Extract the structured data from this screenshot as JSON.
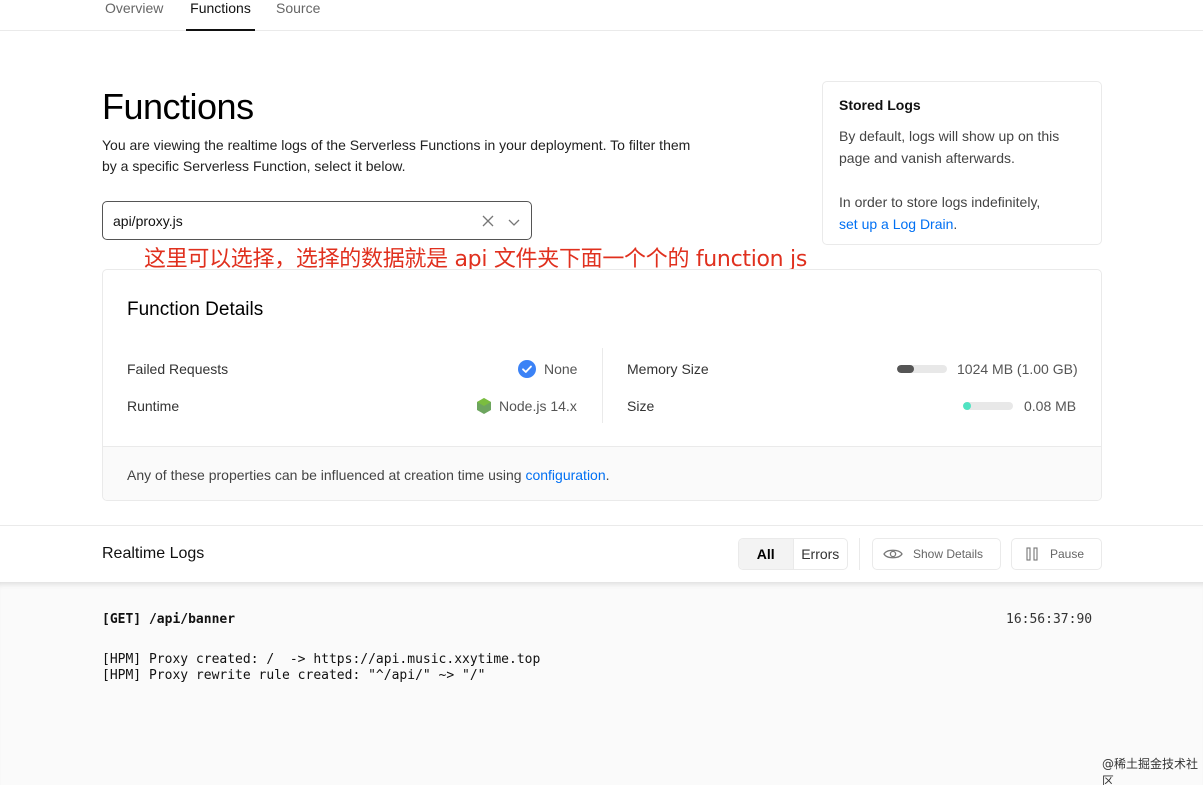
{
  "tabs": [
    {
      "label": "Overview",
      "active": false
    },
    {
      "label": "Functions",
      "active": true
    },
    {
      "label": "Source",
      "active": false
    }
  ],
  "page": {
    "title": "Functions",
    "description": "You are viewing the realtime logs of the Serverless Functions in your deployment. To filter them by a specific Serverless Function, select it below."
  },
  "function_select": {
    "value": "api/proxy.js",
    "icons": [
      "clear-icon",
      "chevron-down-icon"
    ]
  },
  "stored_logs": {
    "title": "Stored Logs",
    "para1": "By default, logs will show up on this page and vanish afterwards.",
    "para2_prefix": "In order to store logs indefinitely,",
    "para2_link": "set up a Log Drain",
    "para2_suffix": "."
  },
  "annotation": "这里可以选择，选择的数据就是 api 文件夹下面一个个的 function js",
  "function_details": {
    "title": "Function Details",
    "failed_requests_label": "Failed Requests",
    "failed_requests_value": "None",
    "runtime_label": "Runtime",
    "runtime_value": "Node.js 14.x",
    "memory_label": "Memory Size",
    "memory_value": "1024 MB (1.00 GB)",
    "memory_fraction": 0.33,
    "size_label": "Size",
    "size_value": "0.08 MB",
    "size_fraction": 0.08,
    "footer_prefix": "Any of these properties can be influenced at creation time using",
    "footer_link": "configuration",
    "footer_suffix": "."
  },
  "realtime_logs": {
    "title": "Realtime Logs",
    "filter_all": "All",
    "filter_errors": "Errors",
    "show_details": "Show Details",
    "pause": "Pause"
  },
  "log_entries": {
    "request": "[GET] /api/banner",
    "time": "16:56:37:90",
    "line1": "[HPM] Proxy created: /  -> https://api.music.xxytime.top",
    "line2": "[HPM] Proxy rewrite rule created: \"^/api/\" ~> \"/\""
  },
  "watermark": "@稀土掘金技术社区",
  "colors": {
    "accent": "#0070f3",
    "annotation": "#e0301e",
    "memory_bar": "#555555",
    "size_bar": "#50e3c2",
    "check": "#0070f3",
    "node": "#6da55f"
  }
}
